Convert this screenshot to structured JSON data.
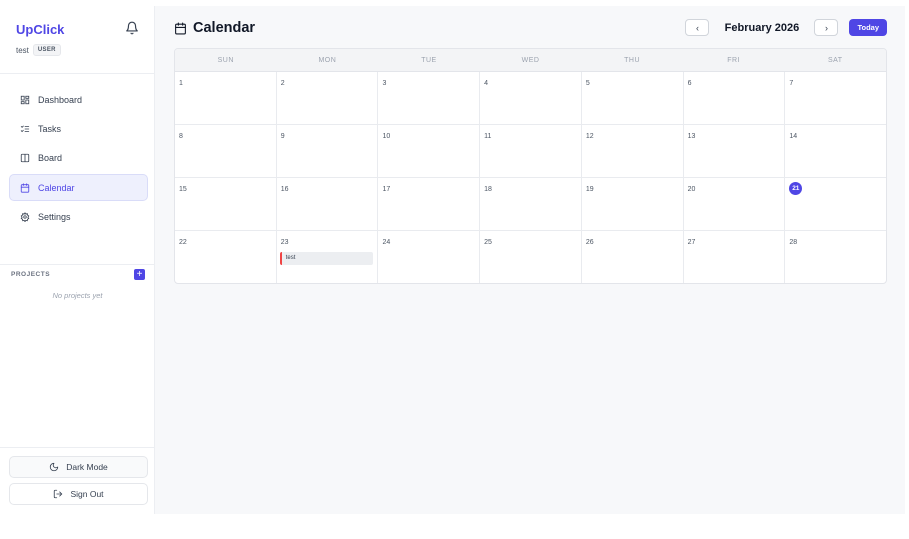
{
  "sidebar": {
    "brand": "UpClick",
    "user_name": "test",
    "user_role": "USER",
    "nav": [
      {
        "label": "Dashboard",
        "icon": "dashboard-icon"
      },
      {
        "label": "Tasks",
        "icon": "tasks-icon"
      },
      {
        "label": "Board",
        "icon": "board-icon"
      },
      {
        "label": "Calendar",
        "icon": "calendar-icon",
        "active": true
      },
      {
        "label": "Settings",
        "icon": "settings-icon"
      }
    ],
    "projects_label": "PROJECTS",
    "projects_empty": "No projects yet",
    "dark_mode_label": "Dark Mode",
    "sign_out_label": "Sign Out"
  },
  "main": {
    "title": "Calendar",
    "month_label": "February 2026",
    "today_label": "Today",
    "prev_label": "‹",
    "next_label": "›",
    "weekdays": [
      "SUN",
      "MON",
      "TUE",
      "WED",
      "THU",
      "FRI",
      "SAT"
    ],
    "weeks": [
      [
        "1",
        "2",
        "3",
        "4",
        "5",
        "6",
        "7"
      ],
      [
        "8",
        "9",
        "10",
        "11",
        "12",
        "13",
        "14"
      ],
      [
        "15",
        "16",
        "17",
        "18",
        "19",
        "20",
        "21"
      ],
      [
        "22",
        "23",
        "24",
        "25",
        "26",
        "27",
        "28"
      ]
    ],
    "today_day": "21",
    "events": [
      {
        "day": "23",
        "title": "test",
        "color": "#ef4444"
      }
    ]
  },
  "colors": {
    "accent": "#4f46e5",
    "event_bar": "#ef4444"
  }
}
